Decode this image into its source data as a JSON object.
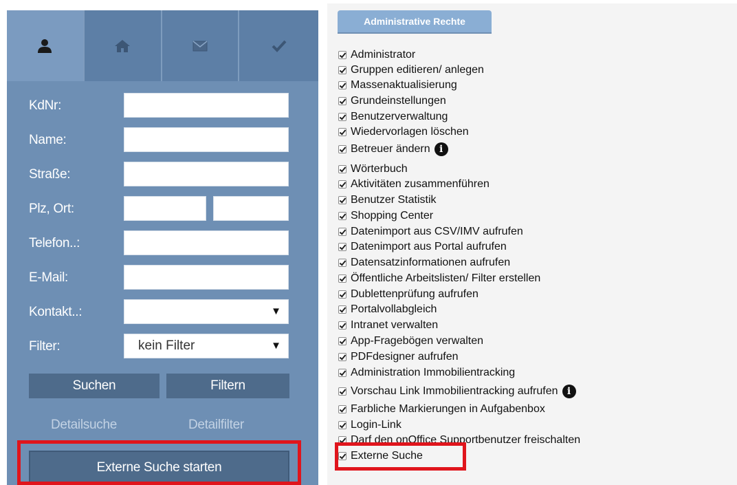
{
  "tabs": [
    {
      "icon": "user-icon",
      "active": true
    },
    {
      "icon": "home-icon",
      "active": false
    },
    {
      "icon": "envelope-icon",
      "active": false
    },
    {
      "icon": "checkmark-icon",
      "active": false
    }
  ],
  "form": {
    "kdnr_label": "KdNr:",
    "kdnr_value": "",
    "name_label": "Name:",
    "name_value": "",
    "strasse_label": "Straße:",
    "strasse_value": "",
    "plz_ort_label": "Plz, Ort:",
    "plz_value": "",
    "ort_value": "",
    "telefon_label": "Telefon..:",
    "telefon_value": "",
    "email_label": "E-Mail:",
    "email_value": "",
    "kontakt_label": "Kontakt..:",
    "kontakt_value": "",
    "filter_label": "Filter:",
    "filter_value": "kein Filter"
  },
  "buttons": {
    "suchen": "Suchen",
    "filtern": "Filtern",
    "detailsuche": "Detailsuche",
    "detailfilter": "Detailfilter",
    "externe_suche_starten": "Externe Suche starten"
  },
  "rights": {
    "tab_label": "Administrative Rechte",
    "items": [
      {
        "label": "Administrator",
        "checked": true
      },
      {
        "label": "Gruppen editieren/ anlegen",
        "checked": true
      },
      {
        "label": "Massenaktualisierung",
        "checked": true
      },
      {
        "label": "Grundeinstellungen",
        "checked": true
      },
      {
        "label": "Benutzerverwaltung",
        "checked": true
      },
      {
        "label": "Wiedervorlagen löschen",
        "checked": true
      },
      {
        "label": "Betreuer ändern",
        "checked": true,
        "info": true
      },
      {
        "label": "Wörterbuch",
        "checked": true
      },
      {
        "label": "Aktivitäten zusammenführen",
        "checked": true
      },
      {
        "label": "Benutzer Statistik",
        "checked": true
      },
      {
        "label": "Shopping Center",
        "checked": true
      },
      {
        "label": "Datenimport aus CSV/IMV aufrufen",
        "checked": true
      },
      {
        "label": "Datenimport aus Portal aufrufen",
        "checked": true
      },
      {
        "label": "Datensatzinformationen aufrufen",
        "checked": true
      },
      {
        "label": "Öffentliche Arbeitslisten/ Filter erstellen",
        "checked": true
      },
      {
        "label": "Dublettenprüfung aufrufen",
        "checked": true
      },
      {
        "label": "Portalvollabgleich",
        "checked": true
      },
      {
        "label": "Intranet verwalten",
        "checked": true
      },
      {
        "label": "App-Fragebögen verwalten",
        "checked": true
      },
      {
        "label": "PDFdesigner aufrufen",
        "checked": true
      },
      {
        "label": "Administration Immobilientracking",
        "checked": true
      },
      {
        "label": "Vorschau Link Immobilientracking aufrufen",
        "checked": true,
        "info": true
      },
      {
        "label": "Farbliche Markierungen in Aufgabenbox",
        "checked": true
      },
      {
        "label": "Login-Link",
        "checked": true
      },
      {
        "label": "Darf den onOffice Supportbenutzer freischalten",
        "checked": true
      },
      {
        "label": "Externe Suche",
        "checked": true
      }
    ]
  },
  "colors": {
    "panel": "#6e8fb4",
    "button": "#4e6b8b",
    "highlight": "#e0151c",
    "tab_accent": "#8aaed4"
  }
}
